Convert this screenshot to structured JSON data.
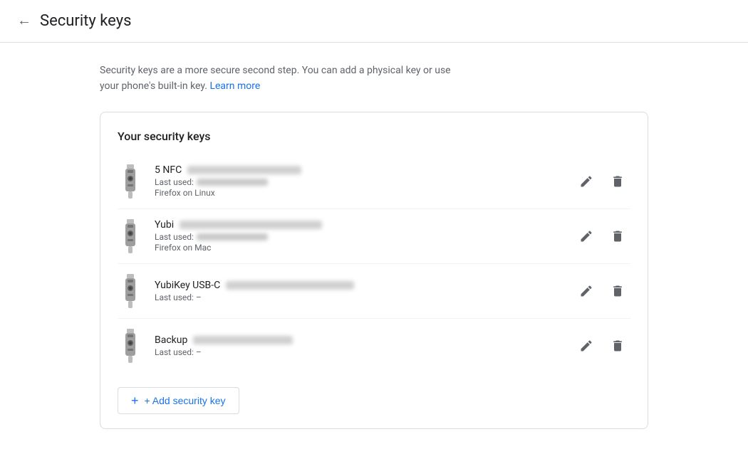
{
  "header": {
    "back_label": "←",
    "title": "Security keys"
  },
  "description": {
    "text": "Security keys are a more secure second step. You can add a physical key or use your phone's built-in key.",
    "learn_more_label": "Learn more",
    "learn_more_url": "#"
  },
  "card": {
    "title": "Your security keys",
    "keys": [
      {
        "id": "key-1",
        "name": "5 NFC",
        "name_suffix_blurred": true,
        "last_used_label": "Last used:",
        "last_used_blurred": true,
        "browser": "Firefox on Linux"
      },
      {
        "id": "key-2",
        "name": "Yubi",
        "name_suffix_blurred": true,
        "last_used_label": "Last used:",
        "last_used_blurred": true,
        "browser": "Firefox on Mac"
      },
      {
        "id": "key-3",
        "name": "YubiKey USB-C",
        "name_suffix_blurred": true,
        "last_used_label": "Last used: –",
        "last_used_blurred": false,
        "browser": ""
      },
      {
        "id": "key-4",
        "name": "Backup",
        "name_suffix_blurred": true,
        "last_used_label": "Last used: –",
        "last_used_blurred": false,
        "browser": ""
      }
    ],
    "add_key_label": "+ Add security key"
  },
  "icons": {
    "back": "←",
    "edit": "✏",
    "delete": "🗑",
    "plus": "+"
  }
}
